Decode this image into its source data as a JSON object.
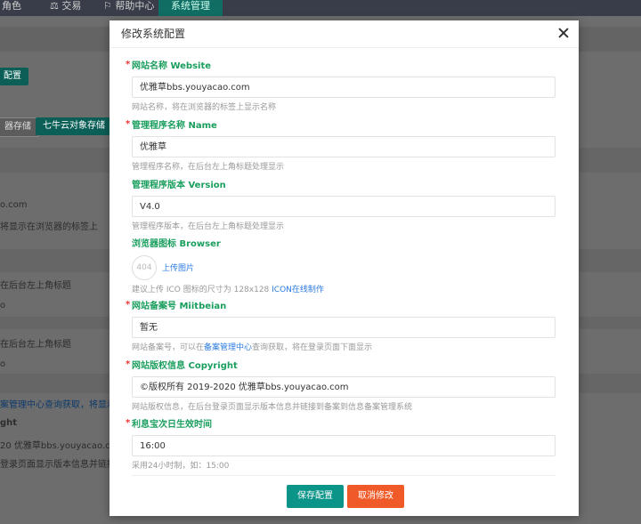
{
  "topnav": {
    "items": [
      "角色",
      "交易",
      "帮助中心",
      "系统管理"
    ]
  },
  "background": {
    "button_config": "配置",
    "button_storage1": "器存储",
    "button_storage2": "七牛云对象存储",
    "lines": [
      "o.com",
      "将显示在浏览器的标签上",
      "在后台左上角标题",
      "o",
      "在后台左上角标题",
      "o",
      "案管理中心查询获取，将显示在登",
      "ght",
      "20 优雅草bbs.youyacao.com",
      "登录页面显示版本信息并链接到备案"
    ]
  },
  "modal": {
    "title": "修改系统配置",
    "fields": [
      {
        "label": "网站名称 Website",
        "required": true,
        "value": "优雅草bbs.youyacao.com",
        "help": "网站名称，将在浏览器的标签上显示名称"
      },
      {
        "label": "管理程序名称 Name",
        "required": true,
        "value": "优雅草",
        "help": "管理程序名称，在后台左上角标题处理显示"
      },
      {
        "label": "管理程序版本 Version",
        "required": false,
        "value": "V4.0",
        "help": "管理程序版本，在后台左上角标题处理显示"
      },
      {
        "label": "网站备案号 Miitbeian",
        "required": true,
        "value": "暂无",
        "help_prefix": "网站备案号，可以在",
        "help_link": "备案管理中心",
        "help_suffix": "查询获取，将在登录页面下面显示"
      },
      {
        "label": "网站版权信息 Copyright",
        "required": true,
        "value": "©版权所有 2019-2020 优雅草bbs.youyacao.com",
        "help": "网站版权信息，在后台登录页面显示版本信息并链接到备案到信息备案管理系统"
      },
      {
        "label": "利息宝次日生效时间",
        "required": true,
        "value": "16:00",
        "help": "采用24小时制，如：15:00"
      }
    ],
    "icon_field": {
      "label": "浏览器图标 Browser",
      "placeholder_img": "404",
      "upload_label": "上传图片",
      "help_prefix": "建议上传 ICO 图标的尺寸为 128x128 ",
      "help_link": "ICON在线制作"
    },
    "save_label": "保存配置",
    "cancel_label": "取消修改"
  }
}
